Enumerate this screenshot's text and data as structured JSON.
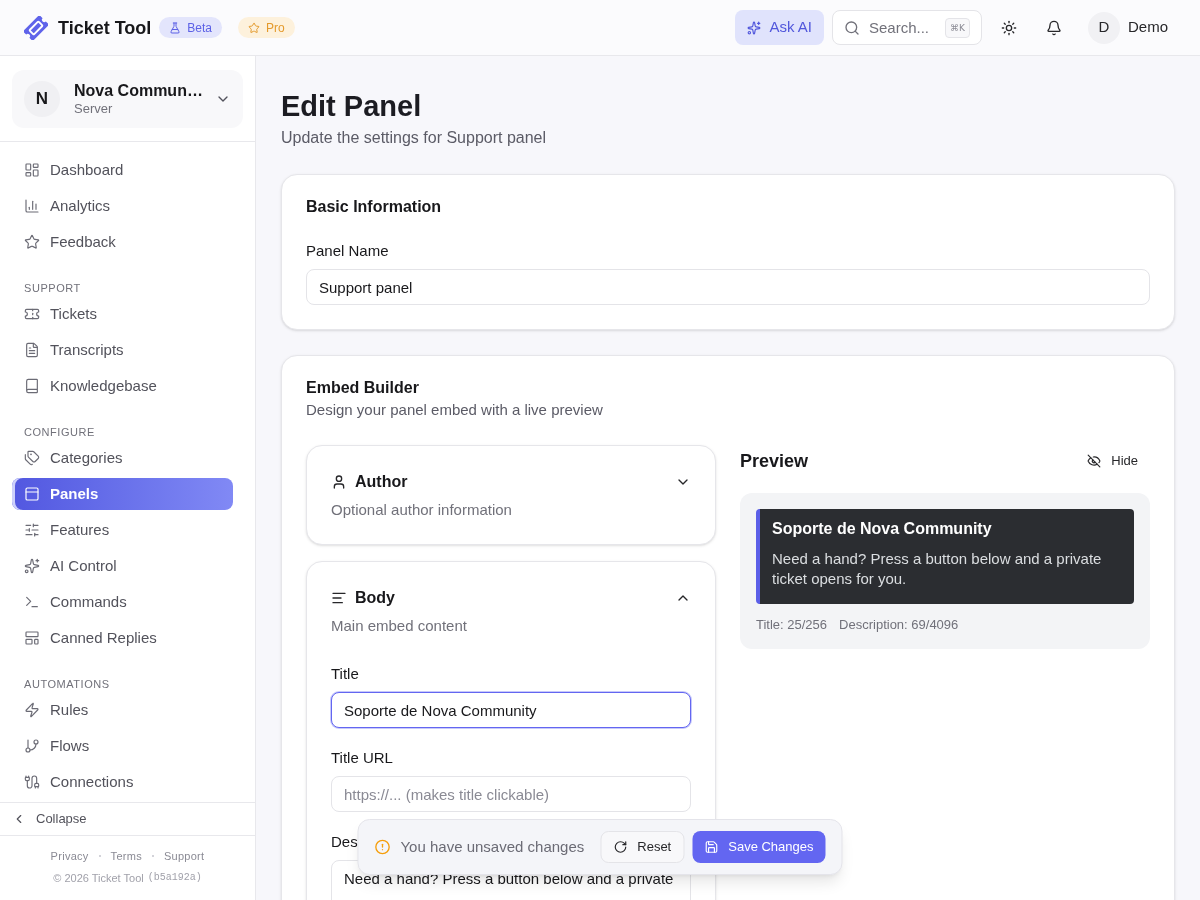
{
  "header": {
    "logo": "Ticket Tool",
    "badges": [
      {
        "kind": "beta",
        "label": "Beta"
      },
      {
        "kind": "pro",
        "label": "Pro"
      }
    ],
    "ask_ai": "Ask AI",
    "search": {
      "placeholder": "Search...",
      "shortcut": "⌘K"
    },
    "user": {
      "initial": "D",
      "name": "Demo"
    }
  },
  "sidebar": {
    "server": {
      "initial": "N",
      "name": "Nova Commun…",
      "subtitle": "Server"
    },
    "sections": [
      {
        "items": [
          {
            "label": "Dashboard",
            "selected": false
          },
          {
            "label": "Analytics",
            "selected": false
          },
          {
            "label": "Feedback",
            "selected": false
          }
        ]
      },
      {
        "heading": "SUPPORT",
        "items": [
          {
            "label": "Tickets",
            "selected": false
          },
          {
            "label": "Transcripts",
            "selected": false
          },
          {
            "label": "Knowledgebase",
            "selected": false
          }
        ]
      },
      {
        "heading": "CONFIGURE",
        "items": [
          {
            "label": "Categories",
            "selected": false
          },
          {
            "label": "Panels",
            "selected": true
          },
          {
            "label": "Features",
            "selected": false
          },
          {
            "label": "AI Control",
            "selected": false
          },
          {
            "label": "Commands",
            "selected": false
          },
          {
            "label": "Canned Replies",
            "selected": false
          }
        ]
      },
      {
        "heading": "AUTOMATIONS",
        "items": [
          {
            "label": "Rules",
            "selected": false
          },
          {
            "label": "Flows",
            "selected": false
          },
          {
            "label": "Connections",
            "selected": false
          }
        ]
      }
    ],
    "collapse": "Collapse",
    "footer_links": [
      "Privacy",
      "Terms",
      "Support"
    ],
    "copyright": "© 2026 Ticket Tool",
    "build": "(b5a192a)"
  },
  "page": {
    "title": "Edit Panel",
    "subtitle": "Update the settings for Support panel"
  },
  "basic_info": {
    "title": "Basic Information",
    "fields": [
      {
        "kind": "input",
        "label": "Panel Name",
        "value": "Support panel",
        "focused": false
      }
    ]
  },
  "embed_builder": {
    "title": "Embed Builder",
    "subtitle": "Design your panel embed with a live preview",
    "sections": [
      {
        "title": "Author",
        "subtitle": "Optional author information",
        "expanded": false
      },
      {
        "title": "Body",
        "subtitle": "Main embed content",
        "expanded": true,
        "fields": [
          {
            "kind": "input",
            "label": "Title",
            "value": "Soporte de Nova Community",
            "focused": true
          },
          {
            "kind": "input",
            "label": "Title URL",
            "placeholder": "https://... (makes title clickable)",
            "focused": false
          },
          {
            "kind": "textarea",
            "label": "Des",
            "value": "Need a hand? Press a button below and a private",
            "focused": false
          }
        ]
      }
    ],
    "preview": {
      "title": "Preview",
      "hide": "Hide",
      "embed": {
        "title": "Soporte de Nova Community",
        "description": "Need a hand? Press a button below and a private ticket opens for you."
      },
      "counters": [
        "Title: 25/256",
        "Description: 69/4096"
      ]
    }
  },
  "unsaved_bar": {
    "message": "You have unsaved changes",
    "reset": "Reset",
    "save": "Save Changes"
  }
}
